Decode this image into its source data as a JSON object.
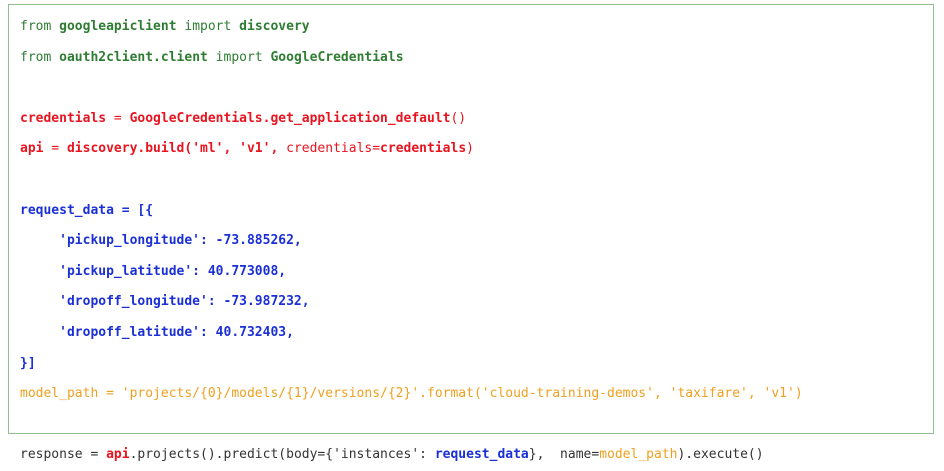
{
  "colors": {
    "panel_border": "#8fbf8f",
    "default_text": "#333333",
    "green": "#2e7d32",
    "red": "#e8141f",
    "blue": "#1a2fd6",
    "orange": "#f0a020"
  },
  "code_lines": [
    [
      {
        "text": "from ",
        "color": "#2e7d32",
        "bold": false
      },
      {
        "text": "googleapiclient",
        "color": "#2e7d32",
        "bold": true
      },
      {
        "text": " import ",
        "color": "#2e7d32",
        "bold": false
      },
      {
        "text": "discovery",
        "color": "#2e7d32",
        "bold": true
      }
    ],
    [
      {
        "text": "from ",
        "color": "#2e7d32",
        "bold": false
      },
      {
        "text": "oauth2client.client",
        "color": "#2e7d32",
        "bold": true
      },
      {
        "text": " import ",
        "color": "#2e7d32",
        "bold": false
      },
      {
        "text": "GoogleCredentials",
        "color": "#2e7d32",
        "bold": true
      }
    ],
    [],
    [
      {
        "text": "credentials",
        "color": "#e8141f",
        "bold": true
      },
      {
        "text": " = ",
        "color": "#e8141f",
        "bold": false
      },
      {
        "text": "GoogleCredentials.get_application_default",
        "color": "#e8141f",
        "bold": true
      },
      {
        "text": "()",
        "color": "#e8141f",
        "bold": false
      }
    ],
    [
      {
        "text": "api",
        "color": "#e8141f",
        "bold": true
      },
      {
        "text": " = ",
        "color": "#e8141f",
        "bold": false
      },
      {
        "text": "discovery.build('ml', 'v1',",
        "color": "#e8141f",
        "bold": true
      },
      {
        "text": " credentials=",
        "color": "#e8141f",
        "bold": false
      },
      {
        "text": "credentials",
        "color": "#e8141f",
        "bold": true
      },
      {
        "text": ")",
        "color": "#e8141f",
        "bold": false
      }
    ],
    [],
    [
      {
        "text": "request_data = [{",
        "color": "#1a2fd6",
        "bold": true
      }
    ],
    [
      {
        "text": "     'pickup_longitude': -73.885262,",
        "color": "#1a2fd6",
        "bold": true
      }
    ],
    [
      {
        "text": "     'pickup_latitude': 40.773008,",
        "color": "#1a2fd6",
        "bold": true
      }
    ],
    [
      {
        "text": "     'dropoff_longitude': -73.987232,",
        "color": "#1a2fd6",
        "bold": true
      }
    ],
    [
      {
        "text": "     'dropoff_latitude': 40.732403,",
        "color": "#1a2fd6",
        "bold": true
      }
    ],
    [
      {
        "text": "}]",
        "color": "#1a2fd6",
        "bold": true
      }
    ],
    [
      {
        "text": "model_path = 'projects/{0}/models/{1}/versions/{2}'.format('cloud-training-demos', 'taxifare', 'v1')",
        "color": "#f0a020",
        "bold": false
      }
    ],
    [],
    [
      {
        "text": "response = ",
        "color": "#333333",
        "bold": false
      },
      {
        "text": "api",
        "color": "#e8141f",
        "bold": true
      },
      {
        "text": ".projects().predict(body={'instances': ",
        "color": "#333333",
        "bold": false
      },
      {
        "text": "request_data",
        "color": "#1a2fd6",
        "bold": true
      },
      {
        "text": "},  name=",
        "color": "#333333",
        "bold": false
      },
      {
        "text": "model_path",
        "color": "#f0a020",
        "bold": false
      },
      {
        "text": ").execute()",
        "color": "#333333",
        "bold": false
      }
    ]
  ]
}
